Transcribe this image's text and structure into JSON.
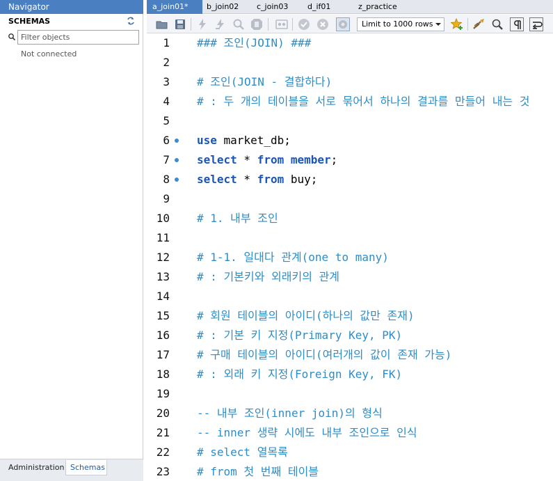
{
  "navigator": {
    "title": "Navigator",
    "schemas_label": "SCHEMAS",
    "filter_placeholder": "Filter objects",
    "status": "Not connected",
    "bottom_tabs": [
      "Administration",
      "Schemas"
    ]
  },
  "editor_tabs": [
    {
      "label": "a_join01*",
      "active": true
    },
    {
      "label": "b_join02",
      "active": false
    },
    {
      "label": "c_join03",
      "active": false
    },
    {
      "label": "d_if01",
      "active": false
    },
    {
      "label": "z_practice",
      "active": false
    }
  ],
  "toolbar": {
    "limit_value": "Limit to 1000 rows",
    "icons": [
      "open-file-icon",
      "save-icon",
      "execute-icon",
      "execute-current-icon",
      "explain-icon",
      "stop-icon",
      "toggle-output-icon",
      "commit-icon",
      "rollback-icon",
      "autocommit-icon",
      "add-snippet-icon",
      "beautify-icon",
      "find-icon",
      "invisible-chars-icon",
      "wrap-icon"
    ]
  },
  "code_lines": [
    {
      "n": "1",
      "marker": false,
      "tokens": [
        {
          "t": "### 조인(JOIN) ###",
          "c": "comment"
        }
      ]
    },
    {
      "n": "2",
      "marker": false,
      "tokens": []
    },
    {
      "n": "3",
      "marker": false,
      "tokens": [
        {
          "t": "# 조인(JOIN - 결합하다)",
          "c": "comment"
        }
      ]
    },
    {
      "n": "4",
      "marker": false,
      "tokens": [
        {
          "t": "# : 두 개의 테이블을 서로 묶어서 하나의 결과를 만들어 내는 것",
          "c": "comment"
        }
      ]
    },
    {
      "n": "5",
      "marker": false,
      "tokens": []
    },
    {
      "n": "6",
      "marker": true,
      "tokens": [
        {
          "t": "use",
          "c": "kw"
        },
        {
          "t": " market_db;",
          "c": "plain"
        }
      ]
    },
    {
      "n": "7",
      "marker": true,
      "tokens": [
        {
          "t": "select",
          "c": "kw"
        },
        {
          "t": " * ",
          "c": "plain"
        },
        {
          "t": "from",
          "c": "kw"
        },
        {
          "t": " member",
          "c": "kw"
        },
        {
          "t": ";",
          "c": "plain"
        }
      ]
    },
    {
      "n": "8",
      "marker": true,
      "tokens": [
        {
          "t": "select",
          "c": "kw"
        },
        {
          "t": " * ",
          "c": "plain"
        },
        {
          "t": "from",
          "c": "kw"
        },
        {
          "t": " buy;",
          "c": "plain"
        }
      ]
    },
    {
      "n": "9",
      "marker": false,
      "tokens": []
    },
    {
      "n": "10",
      "marker": false,
      "tokens": [
        {
          "t": "# 1. 내부 조인",
          "c": "comment"
        }
      ]
    },
    {
      "n": "11",
      "marker": false,
      "tokens": []
    },
    {
      "n": "12",
      "marker": false,
      "tokens": [
        {
          "t": "# 1-1. 일대다 관계(one to many)",
          "c": "comment"
        }
      ]
    },
    {
      "n": "13",
      "marker": false,
      "tokens": [
        {
          "t": "# : 기본키와 외래키의 관계",
          "c": "comment"
        }
      ]
    },
    {
      "n": "14",
      "marker": false,
      "tokens": []
    },
    {
      "n": "15",
      "marker": false,
      "tokens": [
        {
          "t": "# 회원 테이블의 아이디(하나의 값만 존재)",
          "c": "comment"
        }
      ]
    },
    {
      "n": "16",
      "marker": false,
      "tokens": [
        {
          "t": "# : 기본 키 지정(Primary Key, PK)",
          "c": "comment"
        }
      ]
    },
    {
      "n": "17",
      "marker": false,
      "tokens": [
        {
          "t": "# 구매 테이블의 아이디(여러개의 값이 존재 가능)",
          "c": "comment"
        }
      ]
    },
    {
      "n": "18",
      "marker": false,
      "tokens": [
        {
          "t": "# : 외래 키 지정(Foreign Key, FK)",
          "c": "comment"
        }
      ]
    },
    {
      "n": "19",
      "marker": false,
      "tokens": []
    },
    {
      "n": "20",
      "marker": false,
      "tokens": [
        {
          "t": "-- 내부 조인(inner join)의 형식",
          "c": "comment"
        }
      ]
    },
    {
      "n": "21",
      "marker": false,
      "tokens": [
        {
          "t": "-- inner 생략 시에도 내부 조인으로 인식",
          "c": "comment"
        }
      ]
    },
    {
      "n": "22",
      "marker": false,
      "tokens": [
        {
          "t": "# select 열목록",
          "c": "comment"
        }
      ]
    },
    {
      "n": "23",
      "marker": false,
      "tokens": [
        {
          "t": "# from 첫 번째 테이블",
          "c": "comment"
        }
      ]
    }
  ],
  "colors": {
    "accent": "#4a7fc1",
    "comment": "#2d8dc7",
    "keyword": "#1a55b8",
    "marker": "#3a8ad8"
  }
}
